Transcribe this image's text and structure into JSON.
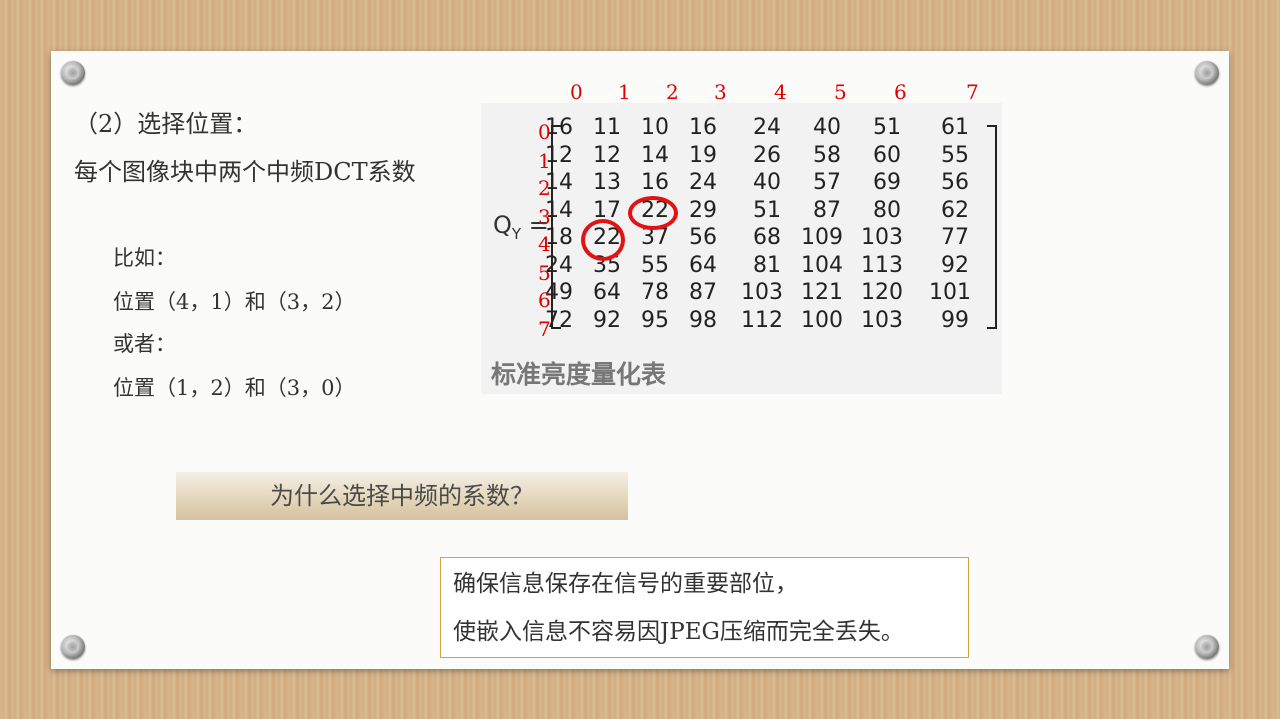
{
  "left": {
    "line1": "（2）选择位置：",
    "line2": "每个图像块中两个中频DCT系数",
    "example_label": "比如：",
    "example_1": "位置（4，1）和（3，2）",
    "or_label": "或者：",
    "example_2": "位置（1，2）和（3，0）"
  },
  "table": {
    "col_indices": [
      "0",
      "1",
      "2",
      "3",
      "4",
      "5",
      "6",
      "7"
    ],
    "row_indices": [
      "0",
      "1",
      "2",
      "3",
      "4",
      "5",
      "6",
      "7"
    ],
    "label": "Q",
    "label_sub": "Y",
    "label_eq": "=",
    "rows": [
      [
        "16",
        "11",
        "10",
        "16",
        "24",
        "40",
        "51",
        "61"
      ],
      [
        "12",
        "12",
        "14",
        "19",
        "26",
        "58",
        "60",
        "55"
      ],
      [
        "14",
        "13",
        "16",
        "24",
        "40",
        "57",
        "69",
        "56"
      ],
      [
        "14",
        "17",
        "22",
        "29",
        "51",
        "87",
        "80",
        "62"
      ],
      [
        "18",
        "22",
        "37",
        "56",
        "68",
        "109",
        "103",
        "77"
      ],
      [
        "24",
        "35",
        "55",
        "64",
        "81",
        "104",
        "113",
        "92"
      ],
      [
        "49",
        "64",
        "78",
        "87",
        "103",
        "121",
        "120",
        "101"
      ],
      [
        "72",
        "92",
        "95",
        "98",
        "112",
        "100",
        "103",
        "99"
      ]
    ],
    "caption": "标准亮度量化表",
    "highlighted": [
      [
        3,
        2
      ],
      [
        4,
        1
      ]
    ],
    "highlight_color": "#e31313"
  },
  "question": "为什么选择中频的系数？",
  "answer": {
    "line1": "确保信息保存在信号的重要部位，",
    "line2": "使嵌入信息不容易因JPEG压缩而完全丢失。"
  }
}
